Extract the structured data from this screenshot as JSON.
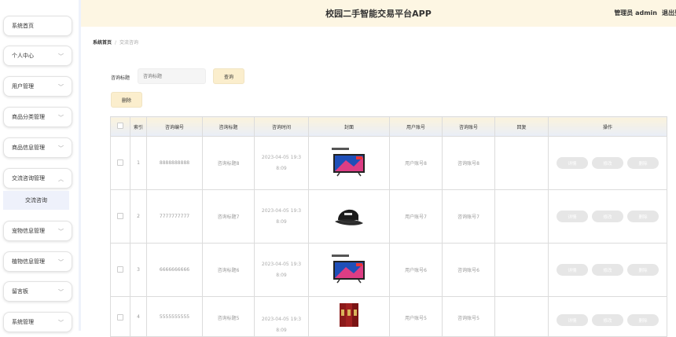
{
  "app": {
    "title": "校园二手智能交易平台APP",
    "admin": "管理员 admin",
    "logout": "退出登"
  },
  "sidebar": {
    "items": [
      {
        "label": "系统首页",
        "chevron": ""
      },
      {
        "label": "个人中心",
        "chevron": "﹀"
      },
      {
        "label": "用户管理",
        "chevron": "﹀"
      },
      {
        "label": "商品分类管理",
        "chevron": "﹀"
      },
      {
        "label": "商品信息管理",
        "chevron": "﹀"
      },
      {
        "label": "交流咨询管理",
        "chevron": "︿"
      },
      {
        "label": "宠物信息管理",
        "chevron": "﹀"
      },
      {
        "label": "植物信息管理",
        "chevron": "﹀"
      },
      {
        "label": "留言板",
        "chevron": "﹀"
      },
      {
        "label": "系统管理",
        "chevron": "﹀"
      }
    ],
    "active_sub": "交流咨询"
  },
  "breadcrumb": {
    "home": "系统首页",
    "current": "交流咨询"
  },
  "search": {
    "label": "咨询标题",
    "placeholder": "咨询标题",
    "query_button": "查询"
  },
  "toolbar": {
    "delete_button": "删除"
  },
  "table": {
    "headers": [
      "",
      "索引",
      "咨询编号",
      "咨询标题",
      "咨询时间",
      "封面",
      "用户账号",
      "咨询账号",
      "回复",
      "操作"
    ],
    "rows": [
      {
        "index": "1",
        "code": "8888888888",
        "title": "咨询标题8",
        "time": "2023-04-05 19:3\n8:09",
        "cover": "tv-icon",
        "user": "用户账号8",
        "consult": "咨询账号8",
        "reply": ""
      },
      {
        "index": "2",
        "code": "7777777777",
        "title": "咨询标题7",
        "time": "2023-04-05 19:3\n8:09",
        "cover": "cap-icon",
        "user": "用户账号7",
        "consult": "咨询账号7",
        "reply": ""
      },
      {
        "index": "3",
        "code": "6666666666",
        "title": "咨询标题6",
        "time": "2023-04-05 19:3\n8:09",
        "cover": "tv-icon",
        "user": "用户账号6",
        "consult": "咨询账号6",
        "reply": ""
      },
      {
        "index": "4",
        "code": "5555555555",
        "title": "咨询标题5",
        "time": "2023-04-05 19:3\n8:09",
        "cover": "books-icon",
        "user": "用户账号5",
        "consult": "咨询账号5",
        "reply": ""
      }
    ],
    "actions": [
      "详情",
      "修改",
      "删除"
    ]
  }
}
